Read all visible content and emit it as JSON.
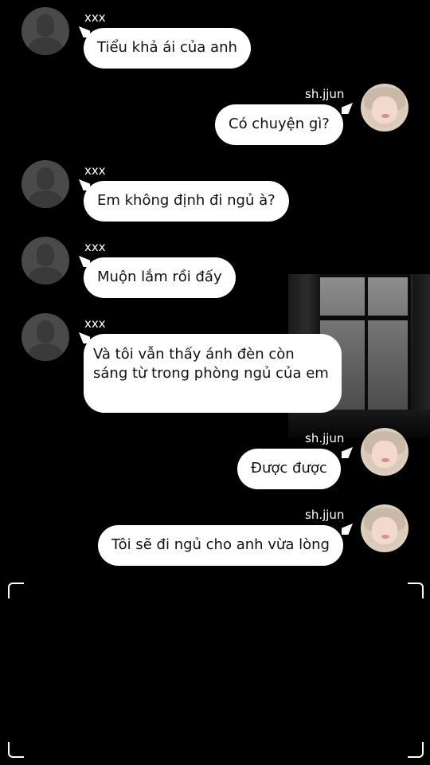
{
  "contacts": {
    "other": {
      "name": "xxx"
    },
    "me": {
      "name": "sh.jjun"
    }
  },
  "messages": [
    {
      "sender": "xxx",
      "text": "Tiểu khả ái của anh"
    },
    {
      "sender": "sh.jjun",
      "text": "Có chuyện gì?"
    },
    {
      "sender": "xxx",
      "text": "Em không định đi ngủ à?"
    },
    {
      "sender": "xxx",
      "text": "Muộn lắm rồi đấy"
    },
    {
      "sender": "xxx",
      "text": " Và tôi vẫn thấy ánh đèn còn sáng từ trong phòng ngủ của em"
    },
    {
      "sender": "sh.jjun",
      "text": "Được được"
    },
    {
      "sender": "sh.jjun",
      "text": "Tôi sẽ đi ngủ cho anh vừa lòng"
    }
  ],
  "theme": {
    "background": "#000000",
    "bubble": "#ffffff",
    "bubble_text": "#111111",
    "name_text": "#ffffff"
  }
}
